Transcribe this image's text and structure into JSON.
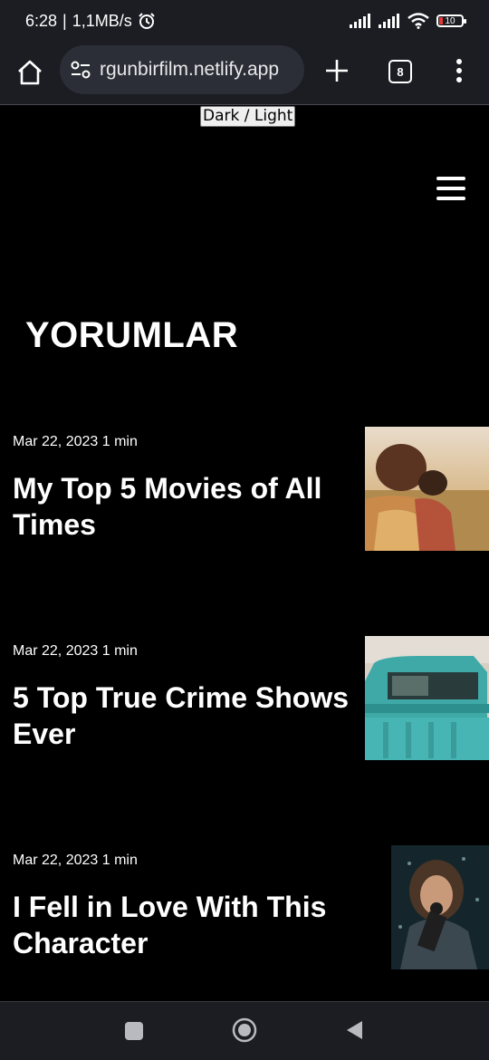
{
  "status": {
    "time": "6:28",
    "speed": "1,1MB/s",
    "battery": "10"
  },
  "browser": {
    "url": "rgunbirfilm.netlify.app",
    "tab_count": "8"
  },
  "page": {
    "theme_toggle": "Dark / Light",
    "title": "YORUMLAR"
  },
  "posts": [
    {
      "meta": "Mar 22, 2023 1 min",
      "title": "My Top 5 Movies of All Times"
    },
    {
      "meta": "Mar 22, 2023 1 min",
      "title": "5 Top True Crime Shows Ever"
    },
    {
      "meta": "Mar 22, 2023 1 min",
      "title": "I Fell in Love With This Character"
    }
  ],
  "icons": {
    "home": "home-icon",
    "site_settings": "site-settings-icon",
    "new_tab": "plus-icon",
    "menu": "more-vertical-icon",
    "hamburger": "hamburger-menu-icon",
    "nav_recent": "square-icon",
    "nav_home": "circle-icon",
    "nav_back": "triangle-back-icon"
  }
}
